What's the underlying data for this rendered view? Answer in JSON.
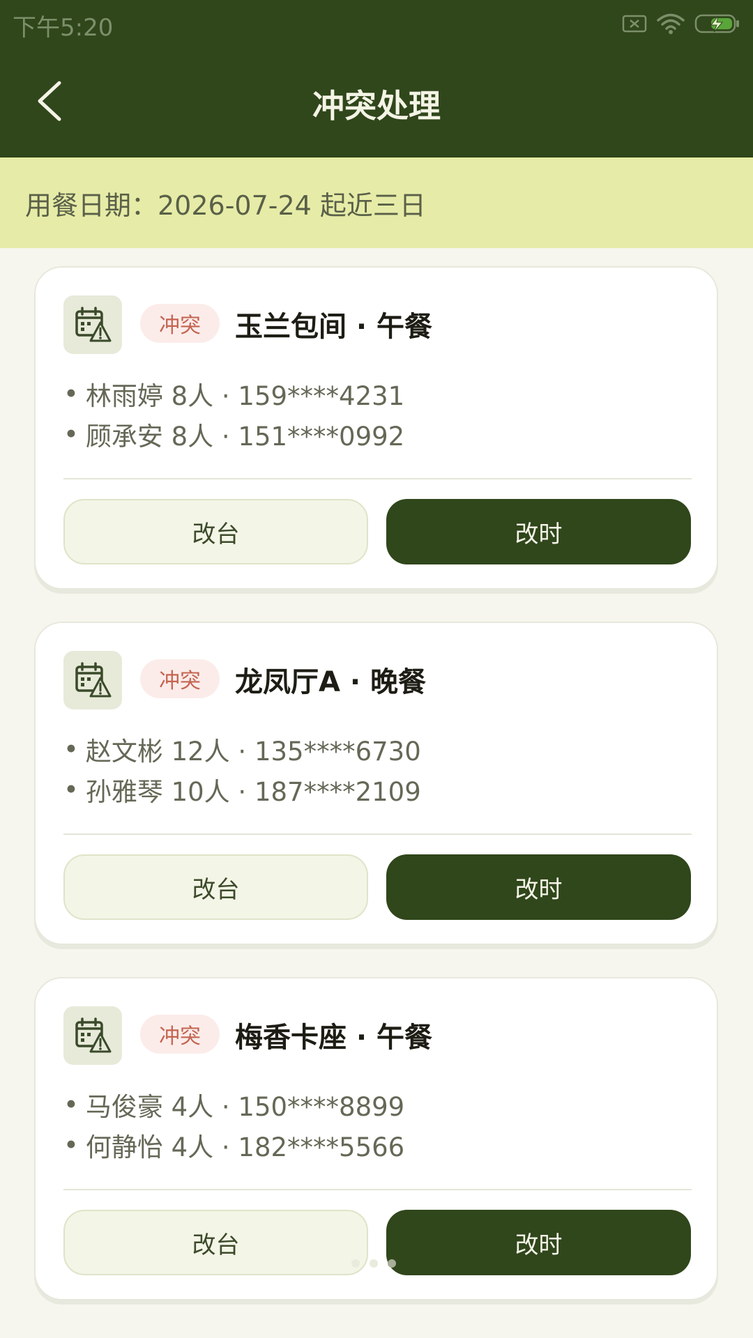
{
  "status_bar": {
    "time": "下午5:20",
    "icons": [
      "sim-x-icon",
      "wifi-icon",
      "battery-charging-icon"
    ]
  },
  "app_bar": {
    "title": "冲突处理",
    "back_icon": "chevron-left-icon"
  },
  "date_banner": {
    "text": "用餐日期：2026-07-24 起近三日"
  },
  "cards": [
    {
      "icon": "calendar-warning-icon",
      "badge": "冲突",
      "title": "玉兰包间 · 午餐",
      "guests": [
        "林雨婷 8人 · 159****4231",
        "顾承安 8人 · 151****0992"
      ],
      "change_table_label": "改台",
      "change_time_label": "改时"
    },
    {
      "icon": "calendar-warning-icon",
      "badge": "冲突",
      "title": "龙凤厅A · 晚餐",
      "guests": [
        "赵文彬 12人 · 135****6730",
        "孙雅琴 10人 · 187****2109"
      ],
      "change_table_label": "改台",
      "change_time_label": "改时"
    },
    {
      "icon": "calendar-warning-icon",
      "badge": "冲突",
      "title": "梅香卡座 · 午餐",
      "guests": [
        "马俊豪 4人 · 150****8899",
        "何静怡 4人 · 182****5566"
      ],
      "change_table_label": "改台",
      "change_time_label": "改时"
    }
  ],
  "colors": {
    "primary": "#30461b",
    "banner": "#e6eca7",
    "badge_bg": "#fbecea",
    "badge_text": "#c46450"
  }
}
